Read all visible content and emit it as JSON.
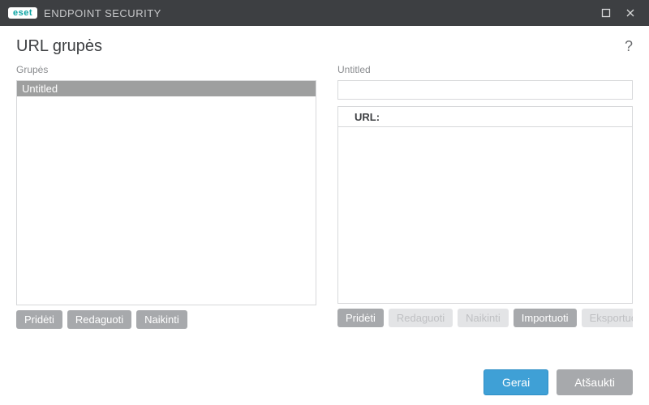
{
  "titlebar": {
    "brand_badge": "eset",
    "brand_text": "ENDPOINT SECURITY"
  },
  "page": {
    "title": "URL grupės",
    "help_symbol": "?"
  },
  "left": {
    "label": "Grupės",
    "rows": [
      "Untitled"
    ],
    "buttons": {
      "add": "Pridėti",
      "edit": "Redaguoti",
      "delete": "Naikinti"
    }
  },
  "right": {
    "label": "Untitled",
    "column_header": "URL:",
    "buttons": {
      "add": "Pridėti",
      "edit": "Redaguoti",
      "delete": "Naikinti",
      "import": "Importuoti",
      "export": "Eksportuoti"
    }
  },
  "footer": {
    "ok": "Gerai",
    "cancel": "Atšaukti"
  }
}
